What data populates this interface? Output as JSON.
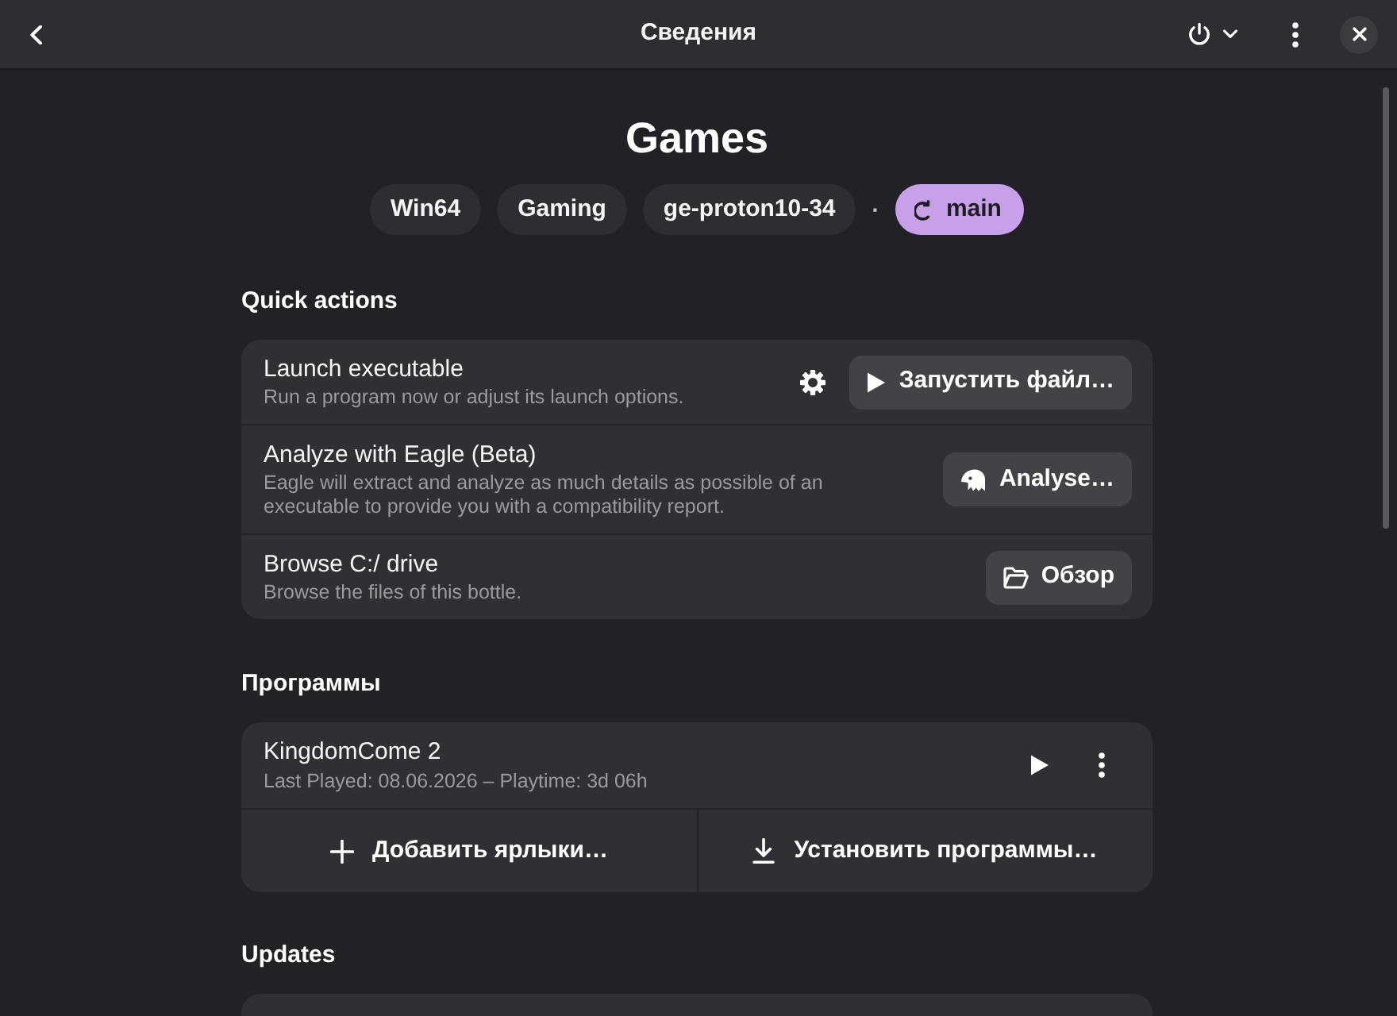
{
  "header": {
    "title": "Сведения"
  },
  "bottle": {
    "name": "Games",
    "environment_tags": [
      "Win64",
      "Gaming",
      "ge-proton10-34"
    ],
    "separator": "·",
    "branch_tag": "main"
  },
  "quick_actions": {
    "title": "Quick actions",
    "rows": [
      {
        "kind": "launch",
        "title": "Launch executable",
        "subtitle": "Run a program now or adjust its launch options.",
        "button": "Запустить файл…"
      },
      {
        "kind": "analyze",
        "title": "Analyze with Eagle (Beta)",
        "subtitle": "Eagle will extract and analyze as much details as possible of an executable to provide you with a compatibility report.",
        "button": "Analyse…"
      },
      {
        "kind": "browse",
        "title": "Browse C:/ drive",
        "subtitle": "Browse the files of this bottle.",
        "button": "Обзор"
      }
    ]
  },
  "programs": {
    "title": "Программы",
    "items": [
      {
        "name": "KingdomCome 2",
        "details": "Last Played: 08.06.2026 – Playtime: 3d 06h"
      }
    ],
    "actions": [
      {
        "kind": "add",
        "label": "Добавить ярлыки…"
      },
      {
        "kind": "install",
        "label": "Установить программы…"
      }
    ]
  },
  "updates": {
    "title": "Updates"
  }
}
